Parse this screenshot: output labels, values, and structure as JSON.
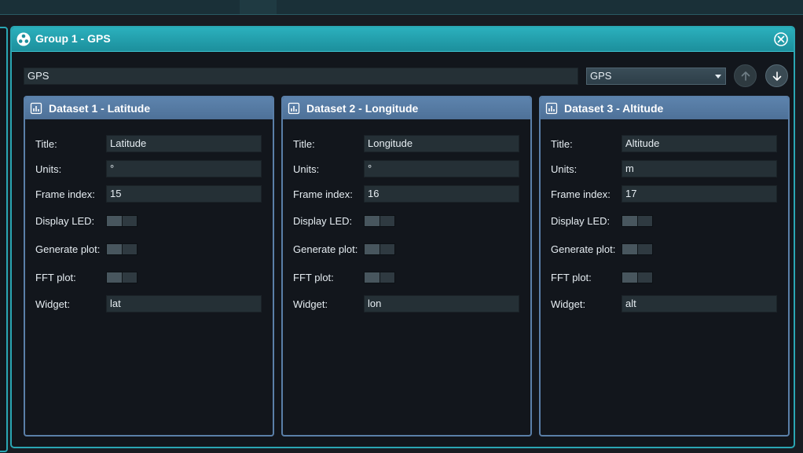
{
  "window": {
    "title": "Group 1 - GPS",
    "group_title_value": "GPS",
    "widget_selected": "GPS"
  },
  "labels": {
    "title": "Title:",
    "units": "Units:",
    "frame_index": "Frame index:",
    "display_led": "Display LED:",
    "generate_plot": "Generate plot:",
    "fft_plot": "FFT plot:",
    "widget": "Widget:"
  },
  "datasets": [
    {
      "header": "Dataset 1 - Latitude",
      "title": "Latitude",
      "units": "°",
      "frame_index": "15",
      "widget": "lat",
      "display_led": false,
      "generate_plot": false,
      "fft_plot": false
    },
    {
      "header": "Dataset 2 - Longitude",
      "title": "Longitude",
      "units": "°",
      "frame_index": "16",
      "widget": "lon",
      "display_led": false,
      "generate_plot": false,
      "fft_plot": false
    },
    {
      "header": "Dataset 3 - Altitude",
      "title": "Altitude",
      "units": "m",
      "frame_index": "17",
      "widget": "alt",
      "display_led": false,
      "generate_plot": false,
      "fft_plot": false
    }
  ],
  "colors": {
    "window_accent": "#2aa6b3",
    "dataset_accent": "#5a7fa8",
    "background": "#12161c"
  },
  "icons": {
    "window": "group-icon",
    "close": "close-icon",
    "dataset": "bar-chart-icon",
    "move_up": "arrow-up-icon",
    "move_down": "arrow-down-icon"
  }
}
